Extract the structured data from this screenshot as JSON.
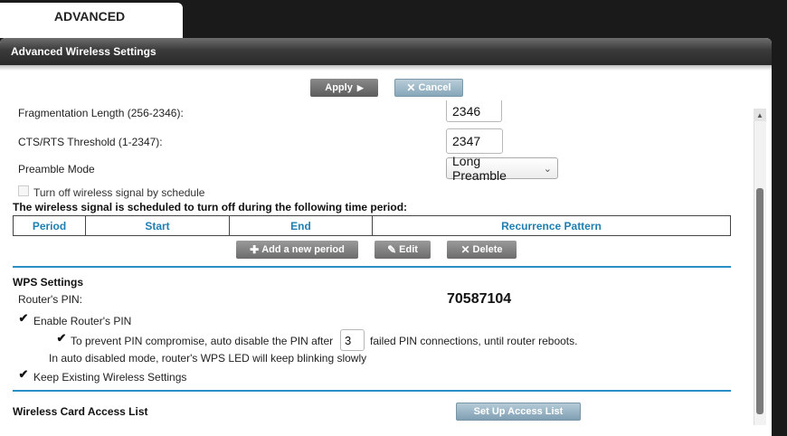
{
  "tab": {
    "label": "ADVANCED"
  },
  "panel": {
    "title": "Advanced Wireless Settings"
  },
  "actions": {
    "apply_label": "Apply",
    "apply_arrow": "▶",
    "cancel_icon": "✕",
    "cancel_label": "Cancel"
  },
  "fields": {
    "fragmentation": {
      "label": "Fragmentation Length (256-2346):",
      "value": "2346"
    },
    "cts_rts": {
      "label": "CTS/RTS Threshold (1-2347):",
      "value": "2347"
    },
    "preamble": {
      "label": "Preamble Mode",
      "value": "Long Preamble"
    }
  },
  "schedule": {
    "checkbox_label": "Turn off wireless signal by schedule",
    "checked": false,
    "heading": "The wireless signal is scheduled to turn off during the following time period:",
    "columns": [
      "Period",
      "Start",
      "End",
      "Recurrence Pattern"
    ],
    "add_label": "Add a new period",
    "edit_label": "Edit",
    "delete_label": "Delete"
  },
  "wps": {
    "heading": "WPS Settings",
    "pin_label": "Router's PIN:",
    "pin_value": "70587104",
    "enable_pin_label": "Enable Router's PIN",
    "enable_pin_checked": true,
    "auto_disable_prefix": "To prevent PIN compromise, auto disable the PIN after",
    "auto_disable_value": "3",
    "auto_disable_suffix": "failed PIN connections, until router reboots.",
    "auto_disable_checked": true,
    "led_note": "In auto disabled mode, router's WPS LED will keep blinking slowly",
    "keep_label": "Keep Existing Wireless Settings",
    "keep_checked": true
  },
  "access_list": {
    "heading": "Wireless Card Access List",
    "button_label": "Set Up Access List"
  },
  "colors": {
    "accent": "#2a8fc4",
    "header_bg": "#3a3a3a",
    "column_text": "#1f7fb0"
  }
}
